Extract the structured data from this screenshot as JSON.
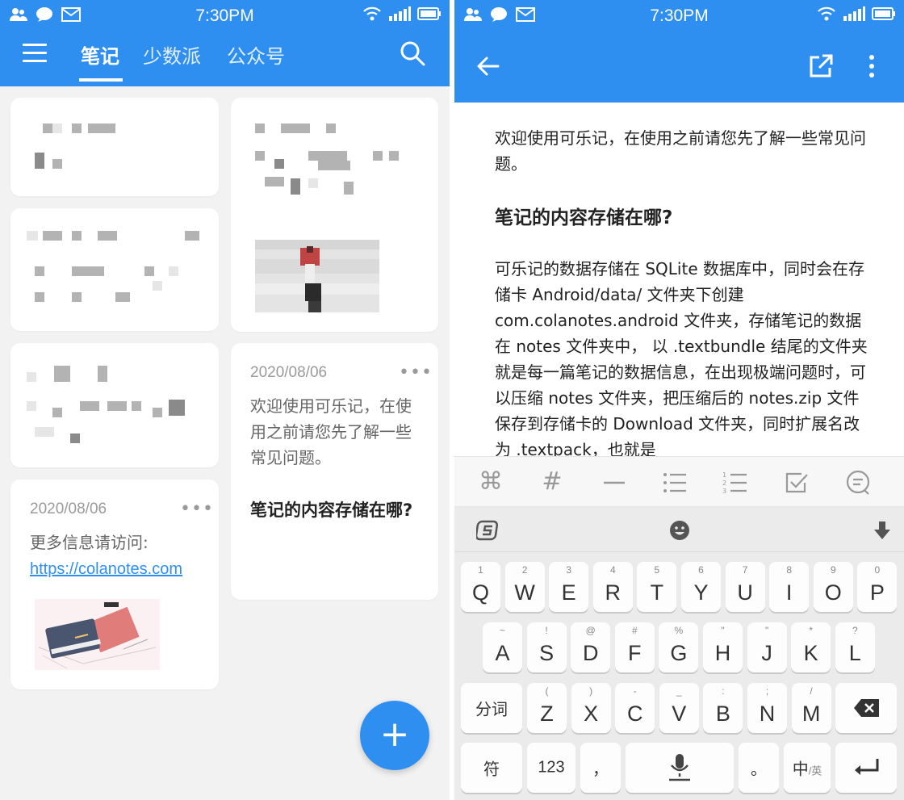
{
  "status_bar": {
    "time": "7:30PM"
  },
  "left": {
    "tabs": [
      "笔记",
      "少数派",
      "公众号"
    ],
    "cards": [
      {
        "date": "2020/08/06",
        "more": "•••",
        "text": "欢迎使用可乐记，在使用之前请您先了解一些常见问题。",
        "heading": "笔记的内容存储在哪?"
      },
      {
        "date": "2020/08/06",
        "more": "•••",
        "text": "更多信息请访问:",
        "link": "https://colanotes.com"
      }
    ],
    "fab_label": "+"
  },
  "right": {
    "note": {
      "intro": "欢迎使用可乐记，在使用之前请您先了解一些常见问题。",
      "heading": "笔记的内容存储在哪?",
      "body": "可乐记的数据存储在 SQLite 数据库中，同时会在存储卡 Android/data/ 文件夹下创建 com.colanotes.android 文件夹，存储笔记的数据在 notes 文件夹中， 以 .textbundle 结尾的文件夹就是每一篇笔记的数据信息，在出现极端问题时，可以压缩 notes 文件夹，把压缩后的 notes.zip 文件保存到存储卡的 Download 文件夹，同时扩展名改为 .textpack，也就是"
    },
    "toolbar_glyphs": [
      "⌘",
      "#"
    ],
    "keyboard": {
      "row1": [
        {
          "k": "Q",
          "h": "1"
        },
        {
          "k": "W",
          "h": "2"
        },
        {
          "k": "E",
          "h": "3"
        },
        {
          "k": "R",
          "h": "4"
        },
        {
          "k": "T",
          "h": "5"
        },
        {
          "k": "Y",
          "h": "6"
        },
        {
          "k": "U",
          "h": "7"
        },
        {
          "k": "I",
          "h": "8"
        },
        {
          "k": "O",
          "h": "9"
        },
        {
          "k": "P",
          "h": "0"
        }
      ],
      "row2": [
        {
          "k": "A",
          "h": "~"
        },
        {
          "k": "S",
          "h": "!"
        },
        {
          "k": "D",
          "h": "@"
        },
        {
          "k": "F",
          "h": "#"
        },
        {
          "k": "G",
          "h": "%"
        },
        {
          "k": "H",
          "h": "\""
        },
        {
          "k": "J",
          "h": "\""
        },
        {
          "k": "K",
          "h": "*"
        },
        {
          "k": "L",
          "h": "?"
        }
      ],
      "row3": [
        {
          "k": "Z",
          "h": "("
        },
        {
          "k": "X",
          "h": ")"
        },
        {
          "k": "C",
          "h": "-"
        },
        {
          "k": "V",
          "h": "_"
        },
        {
          "k": "B",
          "h": ":"
        },
        {
          "k": "N",
          "h": ";"
        },
        {
          "k": "M",
          "h": "/"
        }
      ],
      "fenci": "分词",
      "fu": "符",
      "num": "123",
      "comma": "，",
      "period": "。",
      "lang_main": "中",
      "lang_sub": "/英"
    }
  }
}
